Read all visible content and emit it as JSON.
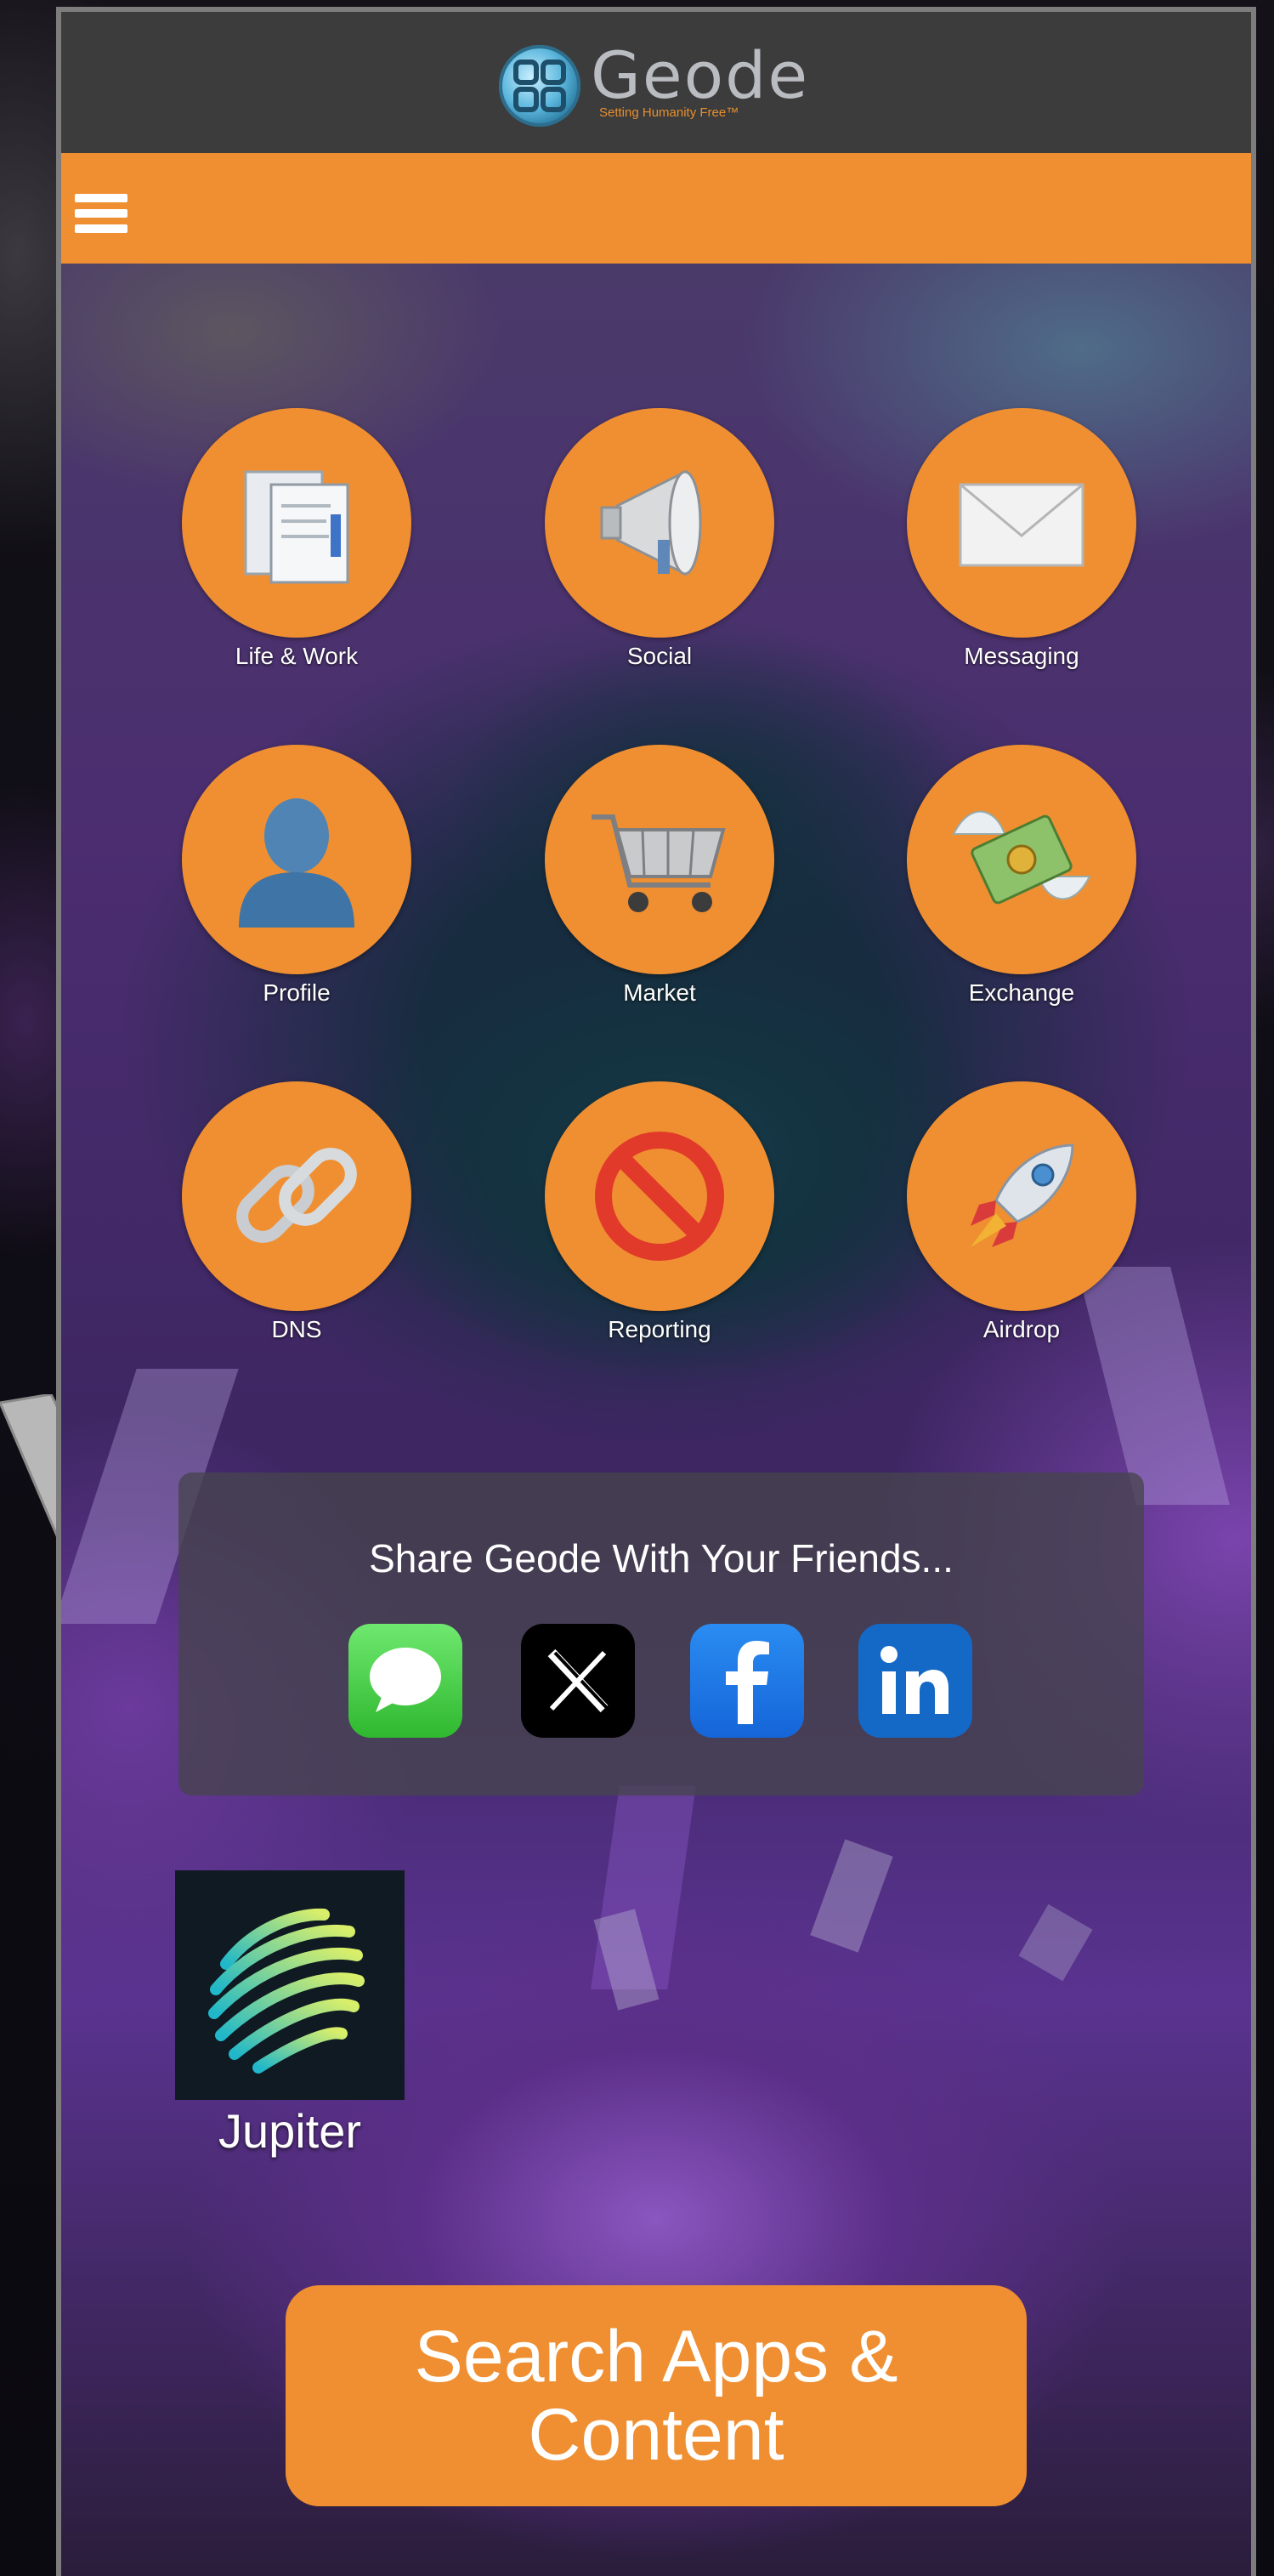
{
  "header": {
    "brand_name": "Geode",
    "tagline": "Setting Humanity Free™",
    "logo_icon": "geode-logo-icon",
    "menu_icon": "hamburger-menu-icon"
  },
  "colors": {
    "accent_orange": "#ef8f32",
    "topbar": "#3c3c3c"
  },
  "tiles": [
    {
      "label": "Life & Work",
      "icon": "documents-icon"
    },
    {
      "label": "Social",
      "icon": "megaphone-icon"
    },
    {
      "label": "Messaging",
      "icon": "envelope-icon"
    },
    {
      "label": "Profile",
      "icon": "user-silhouette-icon"
    },
    {
      "label": "Market",
      "icon": "shopping-cart-icon"
    },
    {
      "label": "Exchange",
      "icon": "money-with-wings-icon"
    },
    {
      "label": "DNS",
      "icon": "chain-link-icon"
    },
    {
      "label": "Reporting",
      "icon": "prohibited-icon"
    },
    {
      "label": "Airdrop",
      "icon": "rocket-icon"
    }
  ],
  "share": {
    "title": "Share Geode With Your Friends...",
    "targets": [
      {
        "name": "messages-icon"
      },
      {
        "name": "x-icon"
      },
      {
        "name": "facebook-icon"
      },
      {
        "name": "linkedin-icon"
      }
    ]
  },
  "jupiter": {
    "label": "Jupiter",
    "icon": "jupiter-logo-icon"
  },
  "search": {
    "label": "Search Apps & Content"
  }
}
